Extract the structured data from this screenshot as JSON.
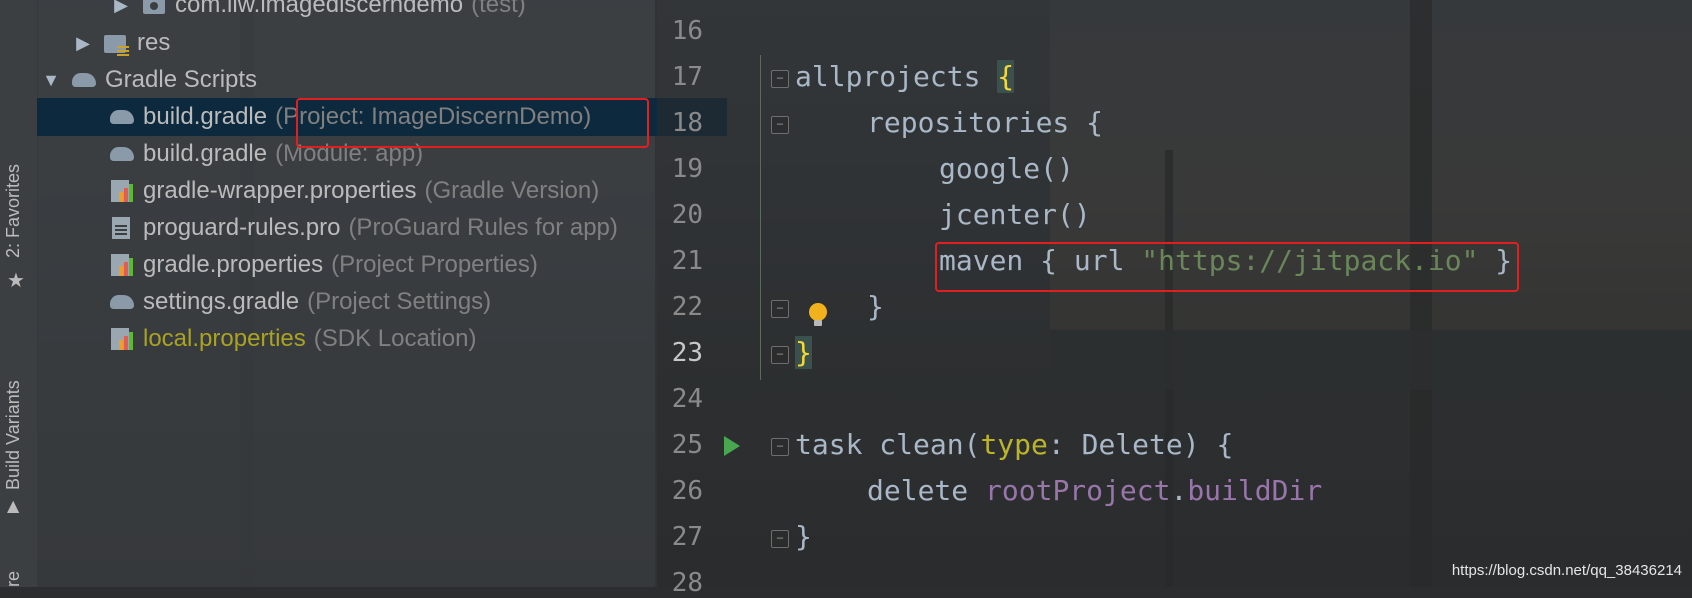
{
  "toolstrip": {
    "favorites_label": "2: Favorites",
    "build_variants_label": "Build Variants",
    "bottom_label": "re"
  },
  "project_tree": {
    "items": [
      {
        "name": "com.llw.imagediscerndemo",
        "hint": "(test)",
        "icon": "package-icon"
      },
      {
        "name": "res",
        "hint": "",
        "icon": "folder-icon"
      },
      {
        "name": "Gradle Scripts",
        "hint": "",
        "icon": "gradle-icon"
      },
      {
        "name": "build.gradle",
        "hint": "(Project: ImageDiscernDemo)",
        "icon": "gradle-icon",
        "selected": true
      },
      {
        "name": "build.gradle",
        "hint": "(Module: app)",
        "icon": "gradle-icon"
      },
      {
        "name": "gradle-wrapper.properties",
        "hint": "(Gradle Version)",
        "icon": "properties-icon"
      },
      {
        "name": "proguard-rules.pro",
        "hint": "(ProGuard Rules for app)",
        "icon": "text-file-icon"
      },
      {
        "name": "gradle.properties",
        "hint": "(Project Properties)",
        "icon": "properties-icon"
      },
      {
        "name": "settings.gradle",
        "hint": "(Project Settings)",
        "icon": "gradle-icon"
      },
      {
        "name": "local.properties",
        "hint": "(SDK Location)",
        "icon": "properties-icon"
      }
    ]
  },
  "editor": {
    "line_numbers": [
      "16",
      "17",
      "18",
      "19",
      "20",
      "21",
      "22",
      "23",
      "24",
      "25",
      "26",
      "27",
      "28"
    ],
    "current_line": "23",
    "code": {
      "l17_kw": "allprojects",
      "l17_brace": "{",
      "l18": "repositories {",
      "l19": "google()",
      "l20": "jcenter()",
      "l21_pre": "maven { url ",
      "l21_str": "\"https://jitpack.io\"",
      "l21_post": " }",
      "l22": "}",
      "l23": "}",
      "l25_kw": "task clean(",
      "l25_param": "type",
      "l25_post": ": Delete) {",
      "l26_pre": "delete ",
      "l26_prop1": "rootProject",
      "l26_dot": ".",
      "l26_prop2": "buildDir",
      "l27": "}"
    }
  },
  "watermark": "https://blog.csdn.net/qq_38436214",
  "colors": {
    "highlight_box": "#e02020",
    "selection": "#0d293e",
    "string": "#6a8759",
    "property": "#9876aa"
  }
}
